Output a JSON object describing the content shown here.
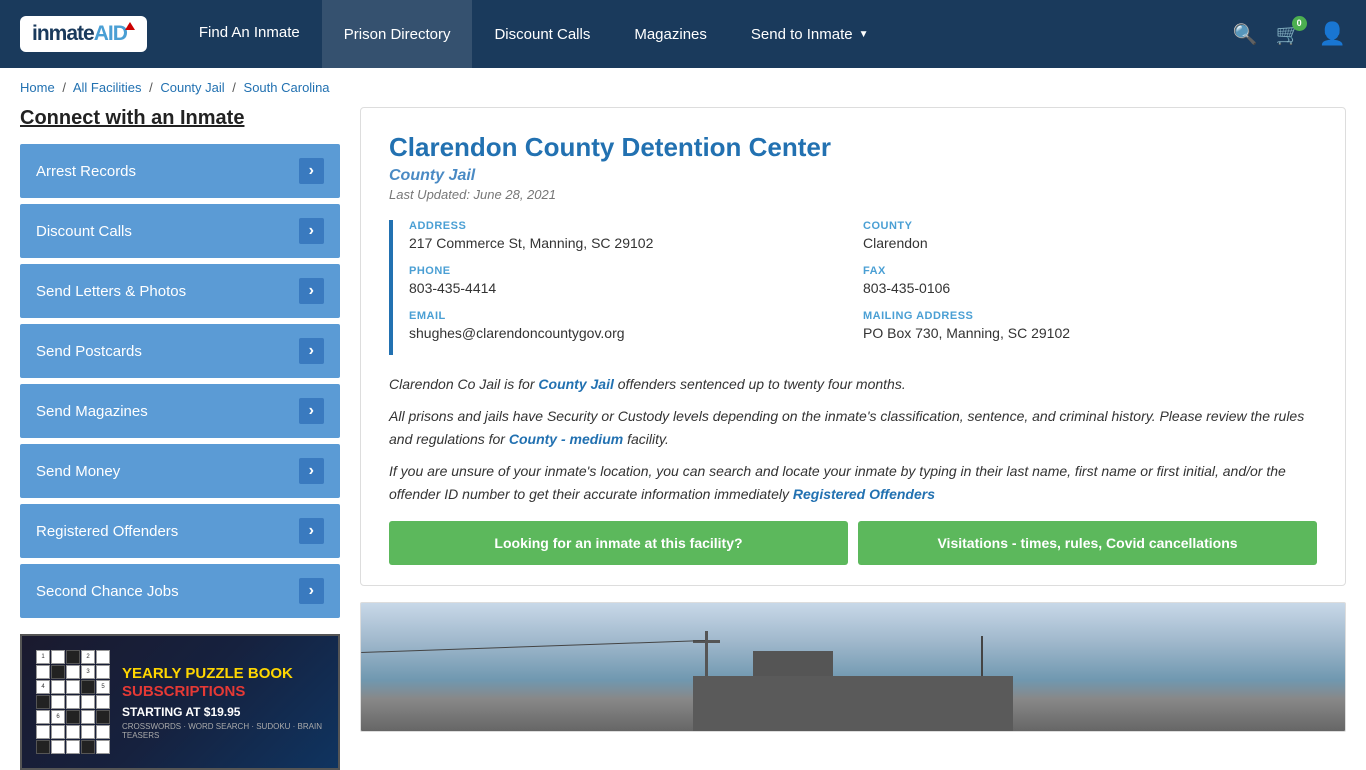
{
  "navbar": {
    "logo": "inmateAID",
    "nav_items": [
      {
        "id": "find-inmate",
        "label": "Find An Inmate"
      },
      {
        "id": "prison-directory",
        "label": "Prison Directory"
      },
      {
        "id": "discount-calls",
        "label": "Discount Calls"
      },
      {
        "id": "magazines",
        "label": "Magazines"
      },
      {
        "id": "send-to-inmate",
        "label": "Send to Inmate",
        "has_dropdown": true
      }
    ],
    "cart_count": "0",
    "icons": {
      "search": "🔍",
      "cart": "🛒",
      "user": "👤"
    }
  },
  "breadcrumb": {
    "items": [
      {
        "label": "Home",
        "href": "#"
      },
      {
        "label": "All Facilities",
        "href": "#"
      },
      {
        "label": "County Jail",
        "href": "#"
      },
      {
        "label": "South Carolina",
        "href": "#"
      }
    ]
  },
  "sidebar": {
    "title": "Connect with an Inmate",
    "menu_items": [
      {
        "id": "arrest-records",
        "label": "Arrest Records"
      },
      {
        "id": "discount-calls",
        "label": "Discount Calls"
      },
      {
        "id": "send-letters-photos",
        "label": "Send Letters & Photos"
      },
      {
        "id": "send-postcards",
        "label": "Send Postcards"
      },
      {
        "id": "send-magazines",
        "label": "Send Magazines"
      },
      {
        "id": "send-money",
        "label": "Send Money"
      },
      {
        "id": "registered-offenders",
        "label": "Registered Offenders"
      },
      {
        "id": "second-chance-jobs",
        "label": "Second Chance Jobs"
      }
    ],
    "ad": {
      "title_line1": "YEARLY PUZZLE BOOK",
      "title_line2": "SUBSCRIPTIONS",
      "starting_at": "STARTING AT $19.95",
      "types": "CROSSWORDS · WORD SEARCH · SUDOKU · BRAIN TEASERS"
    }
  },
  "facility": {
    "name": "Clarendon County Detention Center",
    "type": "County Jail",
    "last_updated": "Last Updated: June 28, 2021",
    "address_label": "ADDRESS",
    "address_value": "217 Commerce St, Manning, SC 29102",
    "county_label": "COUNTY",
    "county_value": "Clarendon",
    "phone_label": "PHONE",
    "phone_value": "803-435-4414",
    "fax_label": "FAX",
    "fax_value": "803-435-0106",
    "email_label": "EMAIL",
    "email_value": "shughes@clarendoncountygov.org",
    "mailing_label": "MAILING ADDRESS",
    "mailing_value": "PO Box 730, Manning, SC 29102",
    "desc1": "Clarendon Co Jail is for County Jail offenders sentenced up to twenty four months.",
    "desc2": "All prisons and jails have Security or Custody levels depending on the inmate's classification, sentence, and criminal history. Please review the rules and regulations for County - medium facility.",
    "desc3": "If you are unsure of your inmate's location, you can search and locate your inmate by typing in their last name, first name or first initial, and/or the offender ID number to get their accurate information immediately Registered Offenders",
    "btn_inmate": "Looking for an inmate at this facility?",
    "btn_visitation": "Visitations - times, rules, Covid cancellations"
  }
}
